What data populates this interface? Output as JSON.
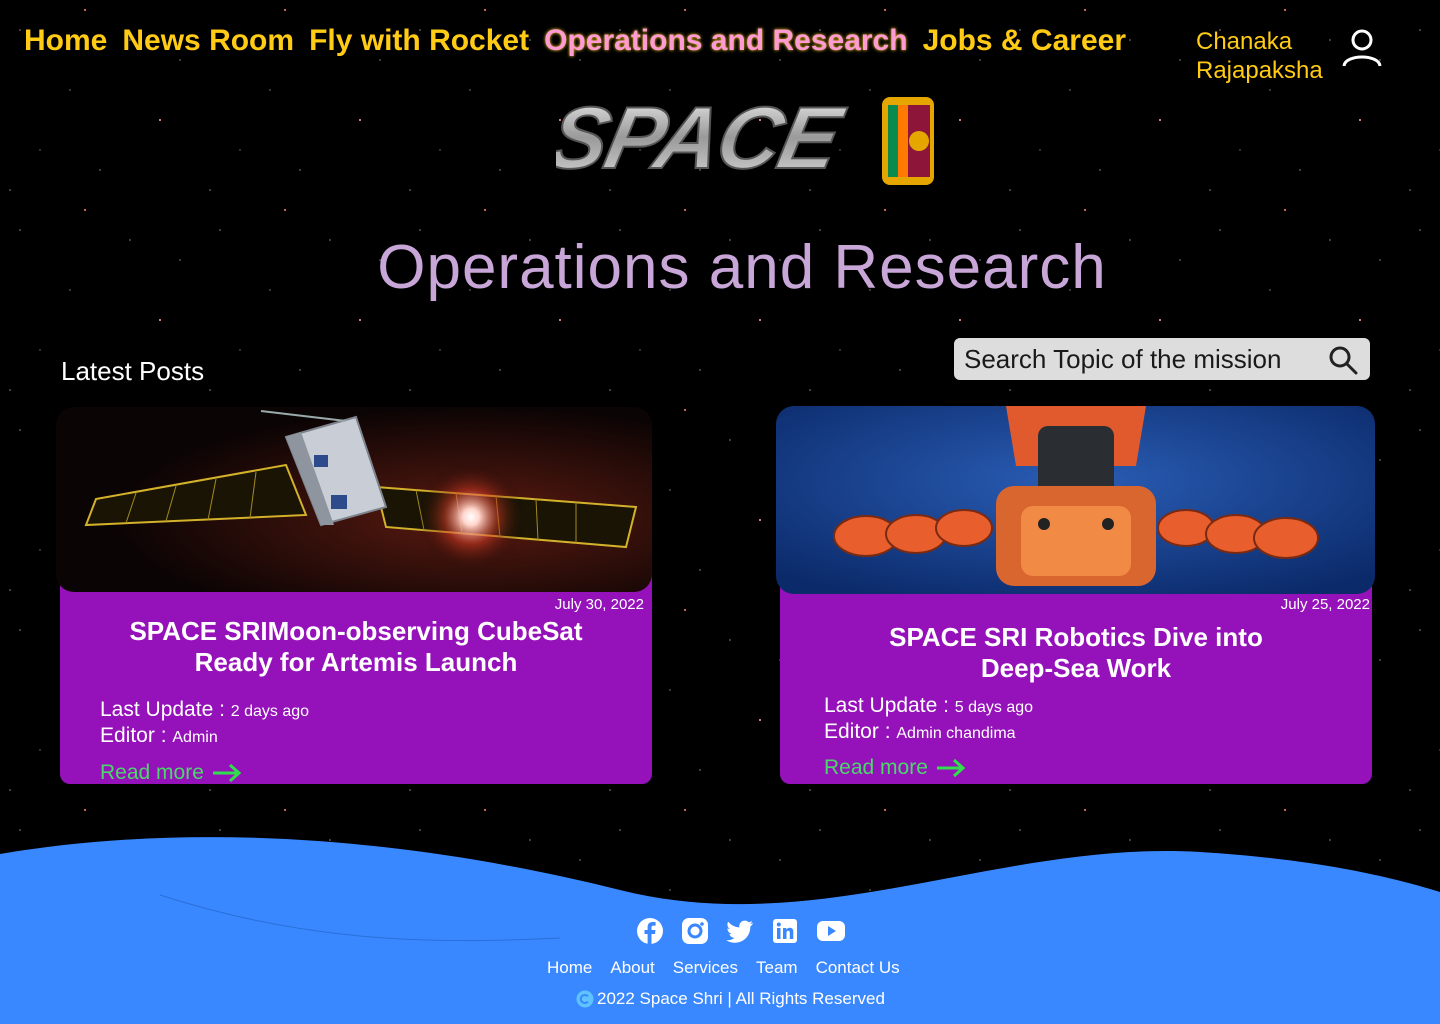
{
  "nav": {
    "items": [
      "Home",
      "News Room",
      "Fly with Rocket",
      "Operations and Research",
      "Jobs & Career"
    ],
    "active": "Operations and Research"
  },
  "user": {
    "first_name": "Chanaka",
    "last_name": "Rajapaksha",
    "icon": "user-icon"
  },
  "logo": {
    "text": "SPACE",
    "icon": "sri-lanka-flag-emblem"
  },
  "page": {
    "title": "Operations and Research"
  },
  "posts": {
    "heading": "Latest Posts",
    "items": [
      {
        "image": "cubesat-solar-panels-image",
        "date": "July 30, 2022",
        "title": "SPACE SRIMoon-observing CubeSat Ready for Artemis Launch",
        "update_label": "Last Update :",
        "update_value": "2 days ago",
        "editor_label": "Editor :",
        "editor_value": "Admin",
        "read_more": "Read more"
      },
      {
        "image": "underwater-robot-image",
        "date": "July 25, 2022",
        "title": "SPACE SRI Robotics Dive into Deep-Sea Work",
        "update_label": "Last Update :",
        "update_value": "5 days ago",
        "editor_label": "Editor :",
        "editor_value": "Admin chandima",
        "read_more": "Read more"
      }
    ]
  },
  "search": {
    "placeholder": "Search Topic of the mission",
    "icon": "search-icon"
  },
  "footer": {
    "social": [
      "facebook-icon",
      "instagram-icon",
      "twitter-icon",
      "linkedin-icon",
      "youtube-icon"
    ],
    "links": [
      "Home",
      "About",
      "Services",
      "Team",
      "Contact Us"
    ],
    "copyright": "2022 Space Shri | All Rights Reserved"
  },
  "colors": {
    "nav": "#ffcb14",
    "nav_active": "#ff9bd3",
    "card": "#9511b9",
    "footer": "#3a88ff",
    "read_more": "#4ad86a",
    "title": "#c9a6d8"
  }
}
